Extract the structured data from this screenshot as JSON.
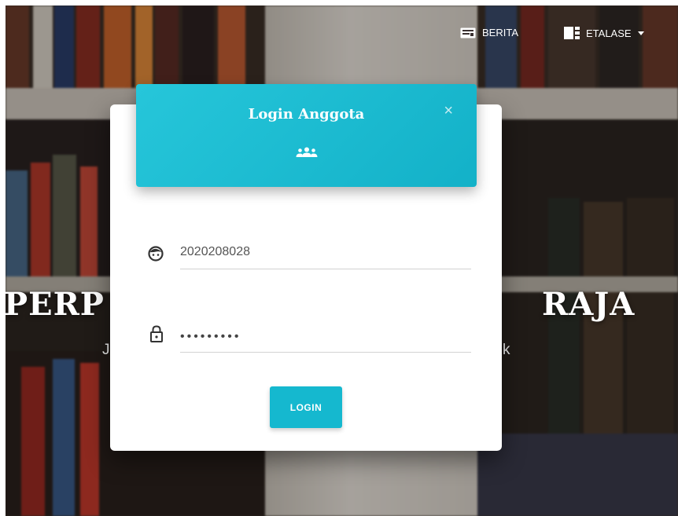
{
  "nav": {
    "berita_label": "BERITA",
    "etalase_label": "ETALASE"
  },
  "hero": {
    "title_left": "PERP",
    "title_right": "RAJA",
    "subtitle_left": "J",
    "subtitle_right": "k"
  },
  "modal": {
    "title": "Login Anggota",
    "close_symbol": "×",
    "username_value": "2020208028",
    "password_mask": "•••••••••",
    "login_label": "LOGIN"
  },
  "colors": {
    "accent": "#26c6da",
    "button": "#15b8cf"
  },
  "icons": {
    "nav_berita": "newspaper-icon",
    "nav_etalase": "grid-icon",
    "dropdown": "caret-down-icon",
    "header": "group-icon",
    "username": "face-icon",
    "password": "lock-icon"
  }
}
